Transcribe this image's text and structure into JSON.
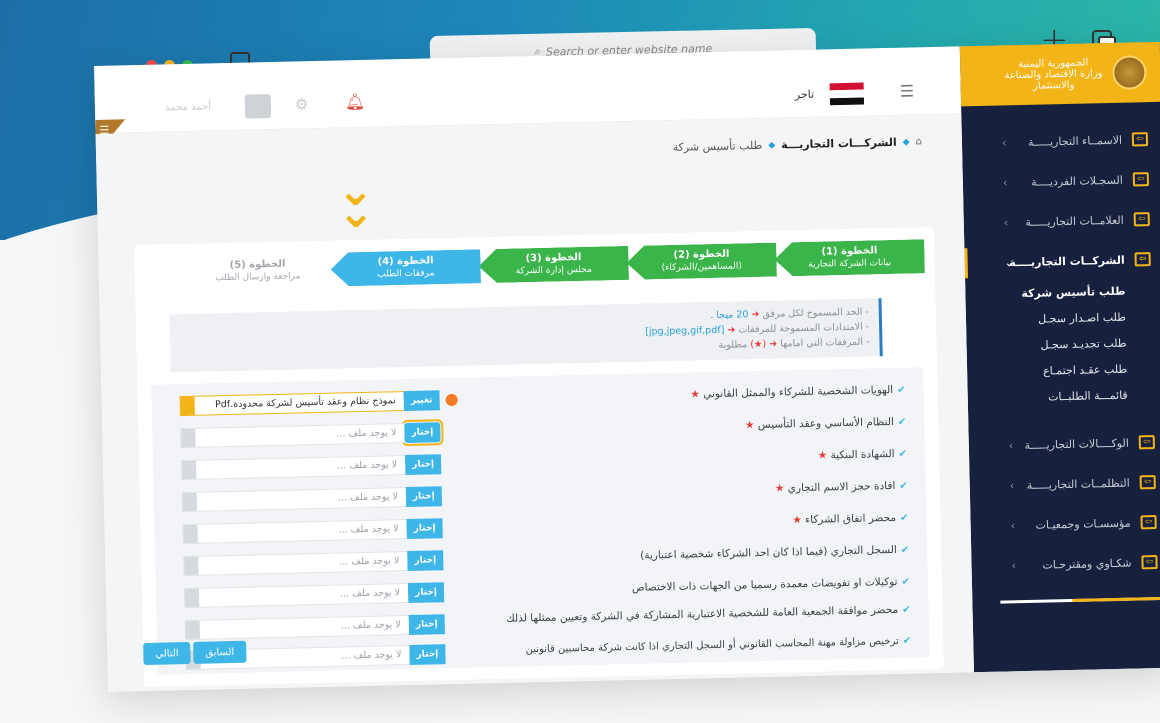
{
  "browser": {
    "address_placeholder": "Search or enter website name",
    "search_icon": "search-icon",
    "colors": {
      "close": "#f04a45",
      "minimize": "#f5b428",
      "maximize": "#2ebd4a"
    }
  },
  "topbar": {
    "user_name": "أحمد محمد",
    "merchant_label": "تاجر"
  },
  "sidebar": {
    "emblem_text": [
      "الجمهورية اليمنية",
      "وزارة الاقتصاد والصناعة",
      "والاستثمار"
    ],
    "items": [
      {
        "label": "الاسمــاء التجاريـــــة",
        "icon": "sign-in-icon"
      },
      {
        "label": "السجـلات الفرديــــة",
        "icon": "sign-in-icon"
      },
      {
        "label": "العلامــات التجاريـــــة",
        "icon": "sign-in-icon"
      },
      {
        "label": "الشركــات التجاريــــة",
        "icon": "sign-in-icon",
        "active": true
      },
      {
        "label": "الوكــــالات التجاريـــــة",
        "icon": "sign-in-icon"
      },
      {
        "label": "التظلمــات التجاريـــــة",
        "icon": "sign-in-icon"
      },
      {
        "label": "مؤسسـات وجمعيـات",
        "icon": "sign-in-icon"
      },
      {
        "label": "شكـاوي ومقترحـات",
        "icon": "sign-in-icon"
      }
    ],
    "sub_items": [
      {
        "label": "طلب تأسيس شركة",
        "active": true
      },
      {
        "label": "طلب اصـدار سجـل"
      },
      {
        "label": "طلب تجديـد سجـل"
      },
      {
        "label": "طلب عقـد اجتمـاع"
      },
      {
        "label": "قائمـــة الطلبــات"
      }
    ],
    "accent": "#f2b417",
    "bg": "#17213d"
  },
  "breadcrumb": {
    "section": "الشركـــات التجاريـــة",
    "current": "طلب تأسيس شركة"
  },
  "steps": [
    {
      "title": "الخطوة (1)",
      "subtitle": "بيانات الشركة التجارية",
      "state": "done"
    },
    {
      "title": "الخطوة (2)",
      "subtitle": "(المساهمين/الشركاء)",
      "state": "done"
    },
    {
      "title": "الخطوة (3)",
      "subtitle": "مجلس إدارة الشركة",
      "state": "done"
    },
    {
      "title": "الخطوة (4)",
      "subtitle": "مرفقات الطلب",
      "state": "current"
    },
    {
      "title": "الخطوة (5)",
      "subtitle": "مراجعة وارسال الطلب",
      "state": "todo"
    }
  ],
  "notes": {
    "line1_prefix": "- الحد المسموح لكل مرفق",
    "line1_value": "20 ميجا .",
    "line2_prefix": "- الامتدادات المسموحة للمرفقات",
    "line2_value": "[jpg,jpeg,gif,pdf]",
    "line3_prefix": "- المرفقات التي امامها",
    "line3_suffix": "مطلوبة",
    "star": "(★)"
  },
  "requirements": [
    {
      "label": "الهويات الشخصية للشركاء والممثل القانوني",
      "required": true
    },
    {
      "label": "النظام الأساسي وعقد التأسيس",
      "required": true
    },
    {
      "label": "الشهادة البنكية",
      "required": true
    },
    {
      "label": "افادة حجز الاسم التجاري",
      "required": true
    },
    {
      "label": "محضر اتفاق الشركاء",
      "required": true
    },
    {
      "label": "السجل التجاري (فيما اذا كان احد الشركاء شخصية اعتبارية)",
      "required": false
    },
    {
      "label": "توكيلات او تفويضات معمدة رسميا من الجهات ذات الاختصاص",
      "required": false
    },
    {
      "label": "محضر موافقة الجمعية العامة للشخصية الاعتبارية المشاركة في الشركة وتعيين ممثلها لذلك",
      "required": false
    },
    {
      "label": "ترخيص مزاولة مهنة المحاسب القانوني أو السجل التجاري اذا كانت شركة محاسبين قانونين",
      "required": false
    }
  ],
  "files": [
    {
      "value": "نموذج نظام وعقد تأسيس لشركة محدودة.Pdf",
      "button": "تغيير"
    },
    {
      "value": "لا يوجد ملف ...",
      "button": "إختار"
    },
    {
      "value": "لا يوجد ملف ...",
      "button": "إختار"
    },
    {
      "value": "لا يوجد ملف ...",
      "button": "إختار"
    },
    {
      "value": "لا يوجد ملف ...",
      "button": "إختار"
    },
    {
      "value": "لا يوجد ملف ...",
      "button": "إختار"
    },
    {
      "value": "لا يوجد ملف ...",
      "button": "إختار"
    },
    {
      "value": "لا يوجد ملف ...",
      "button": "إختار"
    },
    {
      "value": "لا يوجد ملف ...",
      "button": "إختار"
    }
  ],
  "buttons": {
    "prev": "السابق",
    "next": "التالي"
  }
}
